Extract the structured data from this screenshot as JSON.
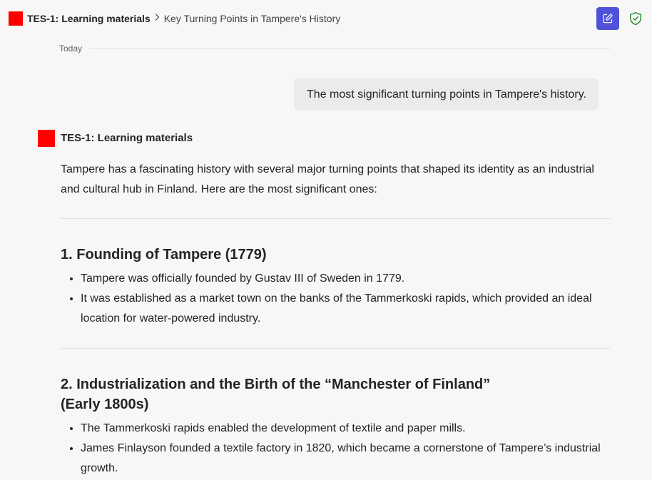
{
  "header": {
    "app_name": "TES-1: Learning materials",
    "separator": ">",
    "conversation_title": "Key Turning Points in Tampere's History"
  },
  "timeline": {
    "date_label": "Today"
  },
  "user_message": {
    "text": "The most significant turning points in Tampere's history."
  },
  "bot_message": {
    "sender": "TES-1: Learning materials",
    "intro": "Tampere has a fascinating history with several major turning points that shaped its identity as an industrial and cultural hub in Finland. Here are the most significant ones:",
    "sections": [
      {
        "title": "1. Founding of Tampere (1779)",
        "points": [
          "Tampere was officially founded by Gustav III of Sweden in 1779.",
          "It was established as a market town on the banks of the Tammerkoski rapids, which provided an ideal location for water-powered industry."
        ]
      },
      {
        "title_line1": "2. Industrialization and the Birth of the “Manchester of Finland”",
        "title_line2": "(Early 1800s)",
        "points": [
          "The Tammerkoski rapids enabled the development of textile and paper mills.",
          "James Finlayson founded a textile factory in 1820, which became a cornerstone of Tampere’s industrial growth."
        ]
      }
    ]
  },
  "colors": {
    "brand_red": "#ff0000",
    "accent": "#4f52d8",
    "shield_green": "#107c10"
  },
  "icons": {
    "new_chat": "compose-icon",
    "security": "shield-check-icon"
  }
}
